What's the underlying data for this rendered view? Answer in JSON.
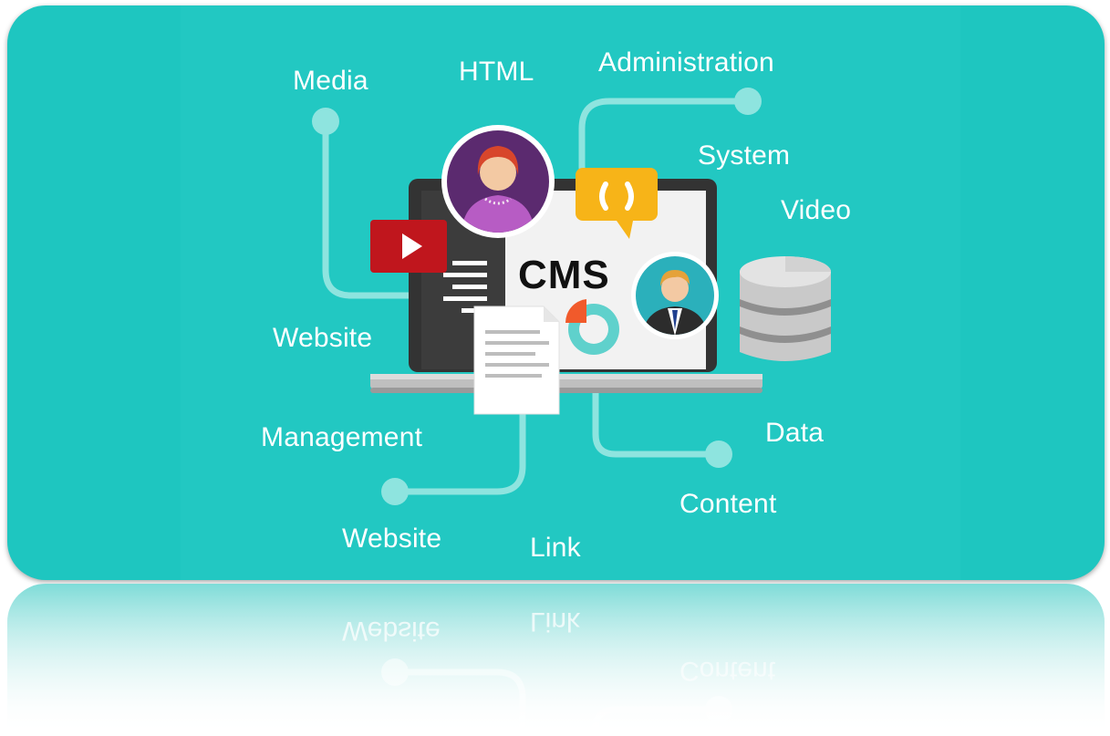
{
  "colors": {
    "background": "#1ec6c0",
    "line": "#8ee4df",
    "laptop_dark": "#333333",
    "video_red": "#c0161d",
    "chat_yellow": "#f7b418",
    "avatar_purple": "#5b2a6f",
    "avatar_teal": "#2bb0bb",
    "pie_orange": "#f15a2b",
    "database_gray": "#c9c9c9"
  },
  "center": {
    "title": "CMS"
  },
  "labels": {
    "media": "Media",
    "html": "HTML",
    "administration": "Administration",
    "system": "System",
    "video": "Video",
    "website_left": "Website",
    "management": "Management",
    "website_bottom": "Website",
    "link": "Link",
    "data": "Data",
    "content": "Content"
  },
  "icons": {
    "video": "play-icon",
    "chat": "chat-bubble-icon",
    "avatar_woman": "woman-avatar-icon",
    "avatar_man": "man-avatar-icon",
    "database": "database-icon",
    "document": "document-icon",
    "pie": "pie-chart-icon"
  }
}
